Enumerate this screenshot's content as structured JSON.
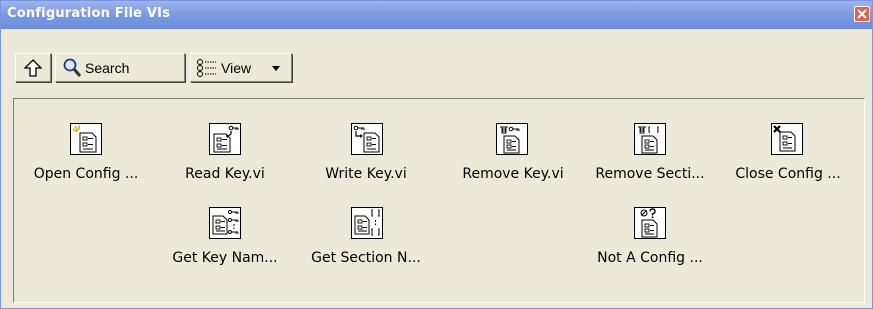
{
  "window": {
    "title": "Configuration File VIs"
  },
  "toolbar": {
    "search_label": "Search",
    "view_label": "View"
  },
  "palette": {
    "items": [
      {
        "label": "Open Config ...",
        "icon": "open-config-icon"
      },
      {
        "label": "Read Key.vi",
        "icon": "read-key-icon"
      },
      {
        "label": "Write Key.vi",
        "icon": "write-key-icon"
      },
      {
        "label": "Remove Key.vi",
        "icon": "remove-key-icon"
      },
      {
        "label": "Remove Secti...",
        "icon": "remove-section-icon"
      },
      {
        "label": "Close Config ...",
        "icon": "close-config-icon"
      },
      {
        "label": "Get Key Nam...",
        "icon": "get-key-names-icon"
      },
      {
        "label": "Get Section N...",
        "icon": "get-section-names-icon"
      },
      {
        "label": "Not A Config ...",
        "icon": "not-a-config-icon"
      }
    ]
  }
}
